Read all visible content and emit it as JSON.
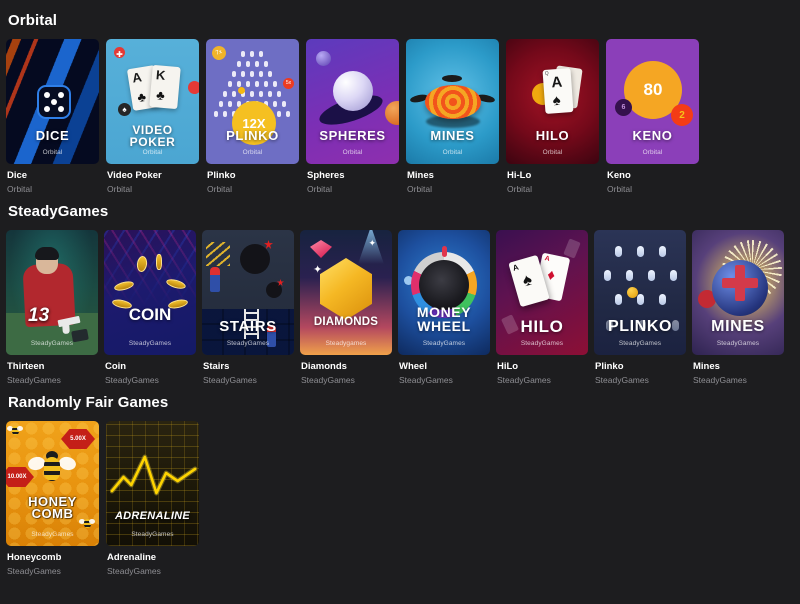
{
  "sections": [
    {
      "title": "Orbital",
      "cards": [
        {
          "name": "Dice",
          "provider": "Orbital",
          "art_title": "DICE",
          "art_sub": "Orbital"
        },
        {
          "name": "Video Poker",
          "provider": "Orbital",
          "art_title": "VIDEO POKER",
          "art_sub": "Orbital"
        },
        {
          "name": "Plinko",
          "provider": "Orbital",
          "art_title": "PLINKO",
          "art_sub": "Orbital",
          "badge": "12X"
        },
        {
          "name": "Spheres",
          "provider": "Orbital",
          "art_title": "SPHERES",
          "art_sub": "Orbital"
        },
        {
          "name": "Mines",
          "provider": "Orbital",
          "art_title": "MINES",
          "art_sub": "Orbital"
        },
        {
          "name": "Hi-Lo",
          "provider": "Orbital",
          "art_title": "HILO",
          "art_sub": "Orbital"
        },
        {
          "name": "Keno",
          "provider": "Orbital",
          "art_title": "KENO",
          "art_sub": "Orbital",
          "badge": "80",
          "badge2": "2",
          "badge3": "6"
        }
      ]
    },
    {
      "title": "SteadyGames",
      "cards": [
        {
          "name": "Thirteen",
          "provider": "SteadyGames",
          "art_title": "13",
          "art_sub": "SteadyGames"
        },
        {
          "name": "Coin",
          "provider": "SteadyGames",
          "art_title": "COIN",
          "art_sub": "SteadyGames"
        },
        {
          "name": "Stairs",
          "provider": "SteadyGames",
          "art_title": "STAIRS",
          "art_sub": "SteadyGames"
        },
        {
          "name": "Diamonds",
          "provider": "SteadyGames",
          "art_title": "DIAMONDS",
          "art_sub": "Steadygames"
        },
        {
          "name": "Wheel",
          "provider": "SteadyGames",
          "art_title": "MONEY WHEEL",
          "art_sub": "SteadyGames"
        },
        {
          "name": "HiLo",
          "provider": "SteadyGames",
          "art_title": "HILO",
          "art_sub": "SteadyGames"
        },
        {
          "name": "Plinko",
          "provider": "SteadyGames",
          "art_title": "PLINKO",
          "art_sub": "SteadyGames"
        },
        {
          "name": "Mines",
          "provider": "SteadyGames",
          "art_title": "MINES",
          "art_sub": "SteadyGames"
        }
      ]
    },
    {
      "title": "Randomly Fair Games",
      "cards": [
        {
          "name": "Honeycomb",
          "provider": "SteadyGames",
          "art_title": "HONEY COMB",
          "art_sub": "SteadyGames",
          "badge": "5.00X",
          "badge2": "10.00X"
        },
        {
          "name": "Adrenaline",
          "provider": "SteadyGames",
          "art_title": "ADRENALINE",
          "art_sub": "SteadyGames"
        }
      ]
    }
  ],
  "cards": {
    "dice": {
      "title": "DICE",
      "sub": "Orbital"
    },
    "video_poker": {
      "title_l1": "VIDEO",
      "title_l2": "POKER",
      "sub": "Orbital",
      "rank_a": "A",
      "rank_k": "K"
    },
    "plinko": {
      "title": "PLINKO",
      "sub": "Orbital",
      "multiplier": "12X",
      "coin": "7x",
      "red": "5x"
    },
    "spheres": {
      "title": "SPHERES",
      "sub": "Orbital"
    },
    "mines": {
      "title": "MINES",
      "sub": "Orbital"
    },
    "hilo": {
      "title": "HILO",
      "sub": "Orbital",
      "rank": "A",
      "suit": "♠",
      "corner": "Q"
    },
    "keno": {
      "title": "KENO",
      "sub": "Orbital",
      "big": "80",
      "small": "6",
      "mid": "2"
    },
    "thirteen": {
      "title": "13",
      "sub": "SteadyGames"
    },
    "coin": {
      "title": "COIN",
      "sub": "SteadyGames"
    },
    "stairs": {
      "title": "STAIRS",
      "sub": "SteadyGames"
    },
    "diamonds": {
      "title": "DIAMONDS",
      "sub": "Steadygames"
    },
    "wheel": {
      "title_l1": "MONEY",
      "title_l2": "WHEEL",
      "sub": "SteadyGames"
    },
    "hilo_sg": {
      "title": "HILO",
      "sub": "SteadyGames",
      "rank_s": "A",
      "suit_s": "♠",
      "rank_d": "A",
      "suit_d": "♦"
    },
    "plinko_sg": {
      "title": "PLINKO",
      "sub": "SteadyGames"
    },
    "mines_sg": {
      "title": "MINES",
      "sub": "SteadyGames"
    },
    "honeycomb": {
      "title_l1": "HONEY",
      "title_l2": "COMB",
      "sub": "SteadyGames",
      "tag1": "5.00X",
      "tag2": "10.00X"
    },
    "adrenaline": {
      "title": "ADRENALINE",
      "sub": "SteadyGames"
    }
  },
  "colors": {
    "page_bg": "#1d1d1f",
    "heading": "#ffffff",
    "card_name": "#ffffff",
    "provider": "#8e8e93"
  }
}
